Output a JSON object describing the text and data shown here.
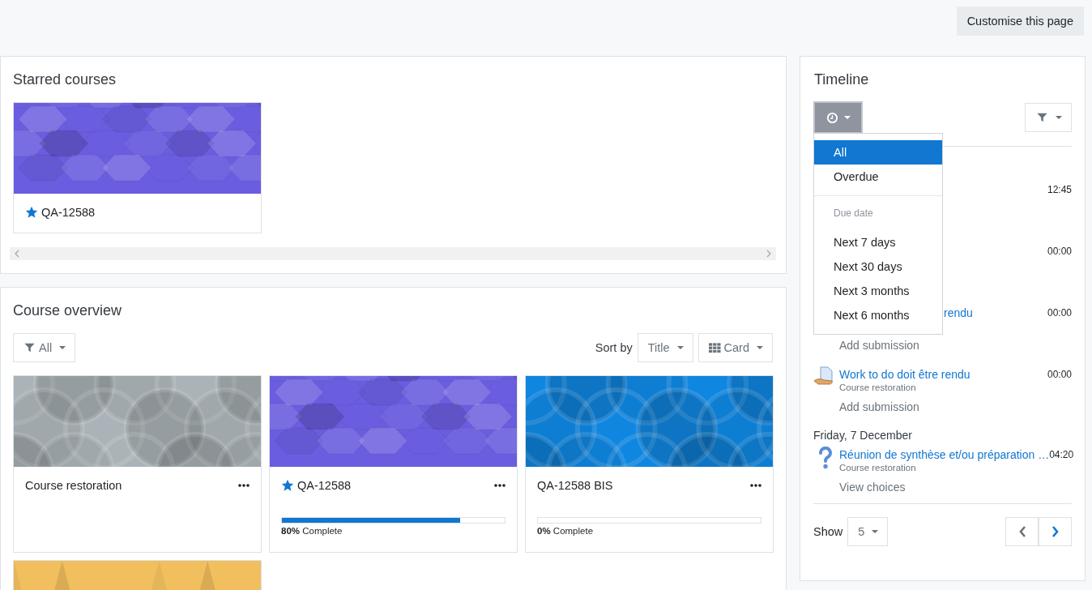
{
  "header": {
    "customise_button": "Customise this page"
  },
  "starred": {
    "title": "Starred courses",
    "courses": [
      {
        "name": "QA-12588",
        "starred": true,
        "color": "#6a5ddf",
        "kind": "hexagons"
      }
    ]
  },
  "overview": {
    "title": "Course overview",
    "filter": "All",
    "sort_label": "Sort by",
    "sort": "Title",
    "view": "Card",
    "courses": [
      {
        "name": "Course restoration",
        "starred": false,
        "color": "#aab3b7",
        "kind": "circles"
      },
      {
        "name": "QA-12588",
        "starred": true,
        "color": "#6a5ddf",
        "kind": "hexagons",
        "level": 0.8,
        "percent": "80%",
        "progress_label": "Complete"
      },
      {
        "name": "QA-12588 BIS",
        "starred": false,
        "color": "#0f86e0",
        "kind": "circles",
        "level": 0,
        "percent": "0%",
        "progress_label": "Complete"
      },
      {
        "color": "#f2bf5e",
        "kind": "triangles"
      }
    ]
  },
  "timeline": {
    "title": "Timeline",
    "menu": [
      {
        "kind": "option",
        "label": "All",
        "selected": true
      },
      {
        "kind": "option",
        "label": "Overdue",
        "selected": false
      },
      {
        "kind": "divider"
      },
      {
        "kind": "header",
        "label": "Due date"
      },
      {
        "kind": "option",
        "label": "Next 7 days",
        "selected": false
      },
      {
        "kind": "option",
        "label": "Next 30 days",
        "selected": false
      },
      {
        "kind": "option",
        "label": "Next 3 months",
        "selected": false
      },
      {
        "kind": "option",
        "label": "Next 6 months",
        "selected": false
      }
    ],
    "entries": [
      {
        "kind": "event",
        "time": "12:45"
      },
      {
        "kind": "event",
        "time": "00:00"
      },
      {
        "kind": "event",
        "title_fragment": "rendu",
        "time": "00:00",
        "action": "Add submission"
      },
      {
        "kind": "assignment_event",
        "title": "Work to do doit être rendu",
        "course": "Course restoration",
        "time": "00:00",
        "action": "Add submission"
      },
      {
        "kind": "date",
        "label": "Friday, 7 December"
      },
      {
        "kind": "choice_event",
        "title": "Réunion de synthèse et/ou préparation …",
        "course": "Course restoration",
        "time": "04:20",
        "action": "View choices"
      }
    ],
    "show_label": "Show",
    "show_value": "5"
  }
}
